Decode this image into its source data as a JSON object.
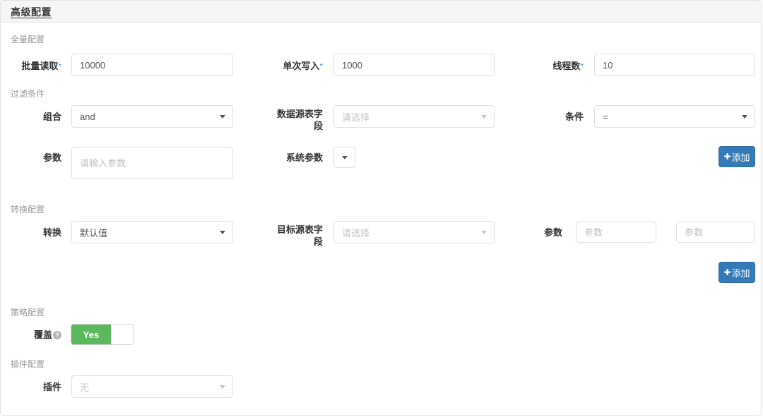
{
  "panel": {
    "title": "高级配置"
  },
  "sections": {
    "full": {
      "title": "全量配置"
    },
    "filter": {
      "title": "过滤条件"
    },
    "transform": {
      "title": "转换配置"
    },
    "strategy": {
      "title": "策略配置"
    },
    "plugin": {
      "title": "插件配置"
    }
  },
  "fields": {
    "batch_read": {
      "label": "批量读取",
      "required_mark": "*",
      "value": "10000"
    },
    "single_write": {
      "label": "单次写入",
      "required_mark": "*",
      "value": "1000"
    },
    "thread_count": {
      "label": "线程数",
      "required_mark": "*",
      "value": "10"
    },
    "combine": {
      "label": "组合",
      "value": "and"
    },
    "source_table_field": {
      "label": "数据源表字段",
      "placeholder": "请选择"
    },
    "condition": {
      "label": "条件",
      "value": "="
    },
    "param": {
      "label": "参数",
      "placeholder": "请输入参数",
      "value": ""
    },
    "system_param": {
      "label": "系统参数",
      "value": ""
    },
    "transform": {
      "label": "转换",
      "value": "默认值"
    },
    "target_table_field": {
      "label": "目标源表字段",
      "placeholder": "请选择"
    },
    "transform_param": {
      "label": "参数",
      "placeholder_1": "参数",
      "placeholder_2": "参数",
      "value_1": "",
      "value_2": ""
    },
    "overwrite": {
      "label": "覆盖",
      "help_icon": "question-mark-icon",
      "state_label": "Yes",
      "enabled": true
    },
    "plugin": {
      "label": "插件",
      "value": "无"
    }
  },
  "buttons": {
    "add_filter": {
      "icon": "plus-icon",
      "plus": "✚",
      "label": "添加"
    },
    "add_transform": {
      "icon": "plus-icon",
      "plus": "✚",
      "label": "添加"
    }
  },
  "colors": {
    "primary": "#337ab7",
    "success": "#5cb85c",
    "required": "#4a90d9",
    "header_bg": "#f5f5f5",
    "border": "#e4e4e4"
  }
}
